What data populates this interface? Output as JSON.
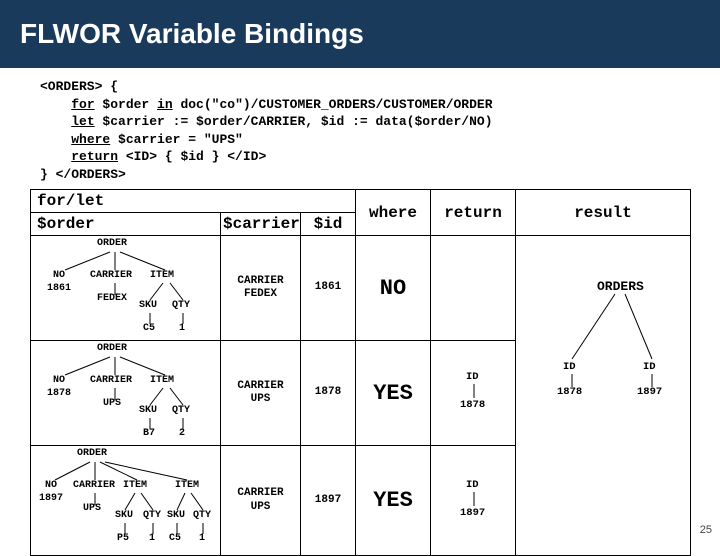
{
  "title": "FLWOR Variable Bindings",
  "code": "<ORDERS> {\n    for $order in doc(\"co\")/CUSTOMER_ORDERS/CUSTOMER/ORDER\n    let $carrier := $order/CARRIER, $id := data($order/NO)\n    where $carrier = \"UPS\"\n    return <ID> { $id } </ID>\n} </ORDERS>",
  "headers": {
    "forlet": "for/let",
    "order_var": "$order",
    "carrier_var": "$carrier",
    "id_var": "$id",
    "where": "where",
    "ret": "return",
    "result": "result"
  },
  "rows": [
    {
      "order_root": "ORDER",
      "no_label": "NO",
      "no": "1861",
      "carrier_label": "CARRIER",
      "carrier": "FEDEX",
      "item_label": "ITEM",
      "items": [
        {
          "sku_label": "SKU",
          "sku": "C5",
          "qty_label": "QTY",
          "qty": "1"
        }
      ],
      "carrier_val_label": "CARRIER",
      "carrier_val": "FEDEX",
      "id": "1861",
      "where": "NO",
      "ret": ""
    },
    {
      "order_root": "ORDER",
      "no_label": "NO",
      "no": "1878",
      "carrier_label": "CARRIER",
      "carrier": "UPS",
      "item_label": "ITEM",
      "items": [
        {
          "sku_label": "SKU",
          "sku": "B7",
          "qty_label": "QTY",
          "qty": "2"
        }
      ],
      "carrier_val_label": "CARRIER",
      "carrier_val": "UPS",
      "id": "1878",
      "where": "YES",
      "ret_id_label": "ID",
      "ret_id": "1878"
    },
    {
      "order_root": "ORDER",
      "no_label": "NO",
      "no": "1897",
      "carrier_label": "CARRIER",
      "carrier": "UPS",
      "item_label": "ITEM",
      "items": [
        {
          "sku_label": "SKU",
          "sku": "P5",
          "qty_label": "QTY",
          "qty": "1"
        },
        {
          "sku_label": "SKU",
          "sku": "C5",
          "qty_label": "QTY",
          "qty": "1"
        }
      ],
      "carrier_val_label": "CARRIER",
      "carrier_val": "UPS",
      "id": "1897",
      "where": "YES",
      "ret_id_label": "ID",
      "ret_id": "1897"
    }
  ],
  "result": {
    "root": "ORDERS",
    "ids": [
      {
        "label": "ID",
        "val": "1878"
      },
      {
        "label": "ID",
        "val": "1897"
      }
    ]
  },
  "page": "25"
}
